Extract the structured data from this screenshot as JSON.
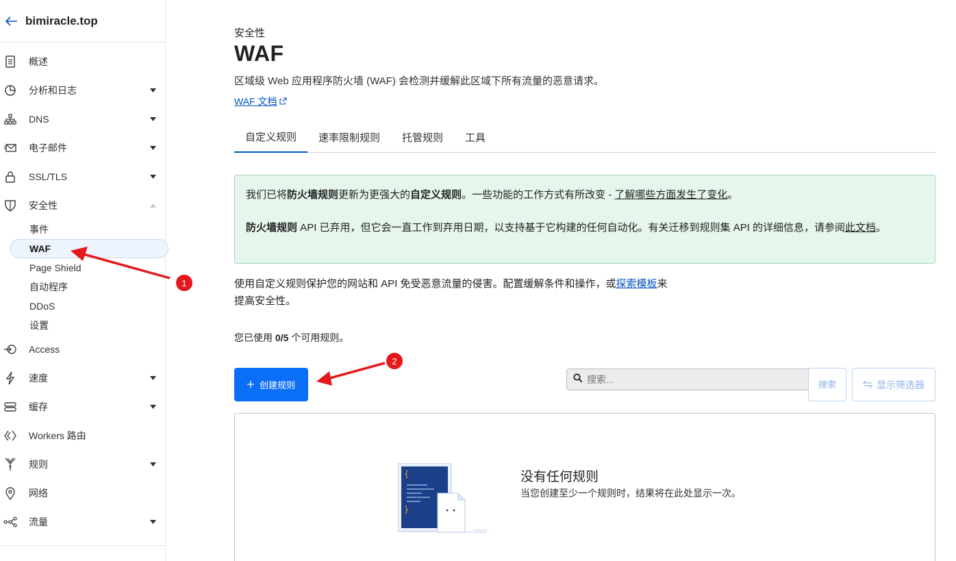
{
  "sidebar": {
    "domain": "bimiracle.top",
    "items": [
      {
        "label": "概述",
        "icon": "document-icon",
        "caret": ""
      },
      {
        "label": "分析和日志",
        "icon": "chart-pie-icon",
        "caret": "down"
      },
      {
        "label": "DNS",
        "icon": "network-icon",
        "caret": "down"
      },
      {
        "label": "电子邮件",
        "icon": "email-icon",
        "caret": "down"
      },
      {
        "label": "SSL/TLS",
        "icon": "lock-icon",
        "caret": "down"
      },
      {
        "label": "安全性",
        "icon": "shield-icon",
        "caret": "up"
      }
    ],
    "security_sub": [
      "事件",
      "WAF",
      "Page Shield",
      "自动程序",
      "DDoS",
      "设置"
    ],
    "items_after": [
      {
        "label": "Access",
        "icon": "access-icon",
        "caret": ""
      },
      {
        "label": "速度",
        "icon": "lightning-icon",
        "caret": "down"
      },
      {
        "label": "缓存",
        "icon": "storage-icon",
        "caret": "down"
      },
      {
        "label": "Workers 路由",
        "icon": "workers-icon",
        "caret": ""
      },
      {
        "label": "规则",
        "icon": "rules-icon",
        "caret": "down"
      },
      {
        "label": "网络",
        "icon": "location-pin-icon",
        "caret": ""
      },
      {
        "label": "流量",
        "icon": "traffic-icon",
        "caret": "down"
      }
    ]
  },
  "header": {
    "breadcrumb": "安全性",
    "title": "WAF",
    "description": "区域级 Web 应用程序防火墙 (WAF) 会检测并缓解此区域下所有流量的恶意请求。",
    "doc_link": "WAF 文档"
  },
  "tabs": [
    "自定义规则",
    "速率限制规则",
    "托管规则",
    "工具"
  ],
  "notice": {
    "p1_a": "我们已将",
    "p1_b": "防火墙规则",
    "p1_c": "更新为更强大的",
    "p1_d": "自定义规则",
    "p1_e": "。一些功能的工作方式有所改变 - ",
    "p1_link": "了解哪些方面发生了变化",
    "p1_f": "。",
    "p2_a": "防火墙规则",
    "p2_b": " API 已弃用，但它会一直工作到弃用日期，以支持基于它构建的任何自动化。有关迁移到规则集 API 的详细信息，请参阅",
    "p2_link": "此文档",
    "p2_c": "。"
  },
  "intro": {
    "text": "使用自定义规则保护您的网站和 API 免受恶意流量的侵害。配置缓解条件和操作，或",
    "link": "探索模板",
    "tail": "来提高安全性。"
  },
  "usage": {
    "prefix": "您已使用 ",
    "count": "0/5",
    "suffix": " 个可用规则。"
  },
  "toolbar": {
    "create_label": "创建规则",
    "search_placeholder": "搜索...",
    "search_button": "搜索",
    "filter_label": "显示筛选器"
  },
  "empty": {
    "title": "没有任何规则",
    "subtitle": "当您创建至少一个规则时，结果将在此处显示一次。"
  },
  "annotations": [
    "1",
    "2"
  ],
  "colors": {
    "accent": "#0a6ef7",
    "link": "#0051c3",
    "notice_bg": "#e6f6ec",
    "annotation": "#e3191b"
  }
}
